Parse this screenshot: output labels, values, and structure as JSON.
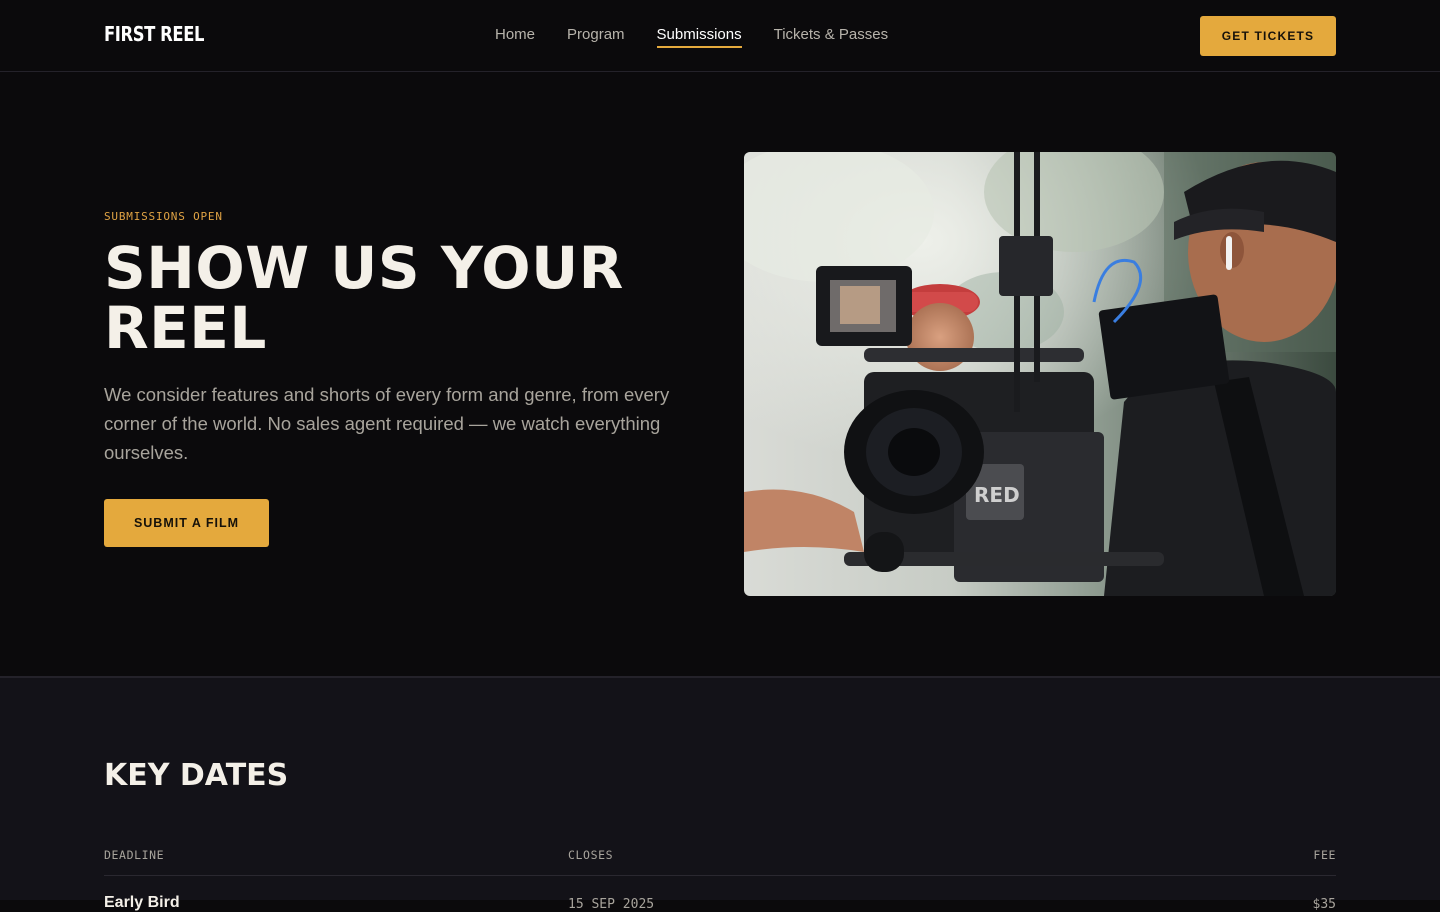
{
  "nav": {
    "logo": "FIRST REEL",
    "items": [
      {
        "label": "Home",
        "active": false
      },
      {
        "label": "Program",
        "active": false
      },
      {
        "label": "Submissions",
        "active": true
      },
      {
        "label": "Tickets & Passes",
        "active": false
      }
    ],
    "cta": "GET TICKETS"
  },
  "hero": {
    "eyebrow": "SUBMISSIONS OPEN",
    "headline": "SHOW US YOUR REEL",
    "lede": "We consider features and shorts of every form and genre, from every corner of the world. No sales agent required — we watch everything ourselves.",
    "cta": "SUBMIT A FILM",
    "photo_alt": "camera-operator-photo"
  },
  "key_dates": {
    "title": "KEY DATES",
    "columns": [
      "DEADLINE",
      "CLOSES",
      "FEE"
    ],
    "rows": [
      {
        "deadline": "Early Bird",
        "closes": "15 SEP 2025",
        "fee": "$35"
      }
    ]
  },
  "colors": {
    "accent": "#e4a93d",
    "background": "#0b0a0c",
    "section_background": "#131218"
  }
}
